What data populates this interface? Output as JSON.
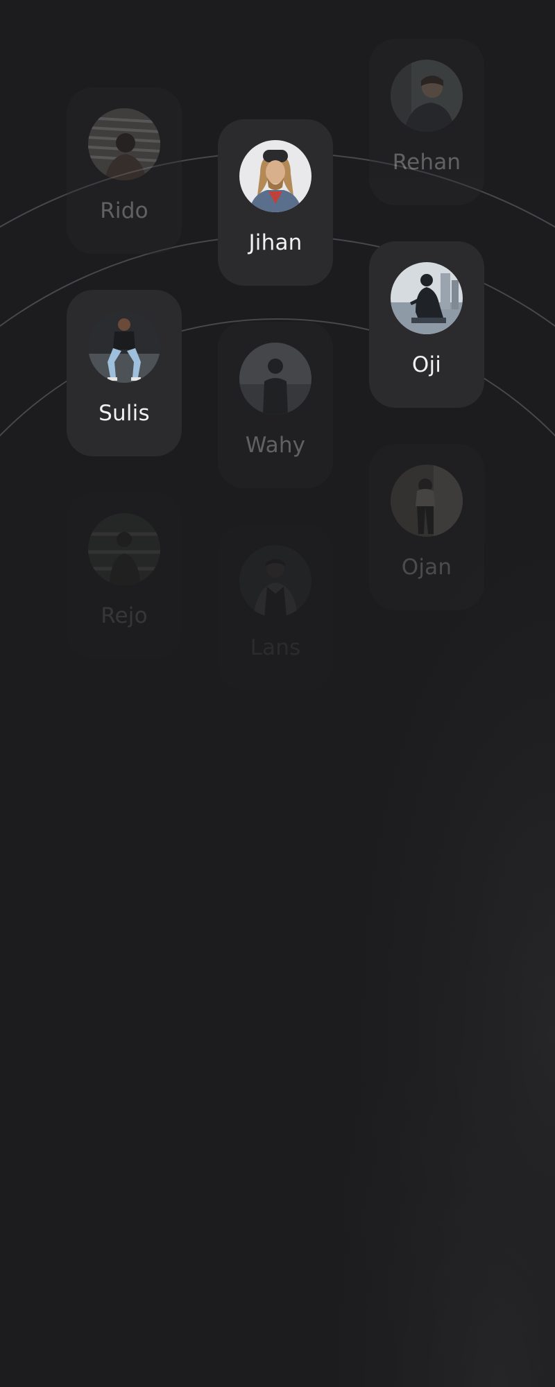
{
  "people": [
    {
      "name": "Rido",
      "avatar_icon": "person-photo-icon"
    },
    {
      "name": "Jihan",
      "avatar_icon": "person-photo-icon"
    },
    {
      "name": "Rehan",
      "avatar_icon": "person-photo-icon"
    },
    {
      "name": "Oji",
      "avatar_icon": "person-photo-icon"
    },
    {
      "name": "Sulis",
      "avatar_icon": "person-photo-icon"
    },
    {
      "name": "Wahy",
      "avatar_icon": "person-photo-icon"
    },
    {
      "name": "Ojan",
      "avatar_icon": "person-photo-icon"
    },
    {
      "name": "Rejo",
      "avatar_icon": "person-photo-icon"
    },
    {
      "name": "Lans",
      "avatar_icon": "person-photo-icon"
    }
  ],
  "colors": {
    "background": "#1c1c1e",
    "card": "#2b2b2e",
    "text": "#f2f2f4",
    "arc": "#4a4a4e"
  }
}
